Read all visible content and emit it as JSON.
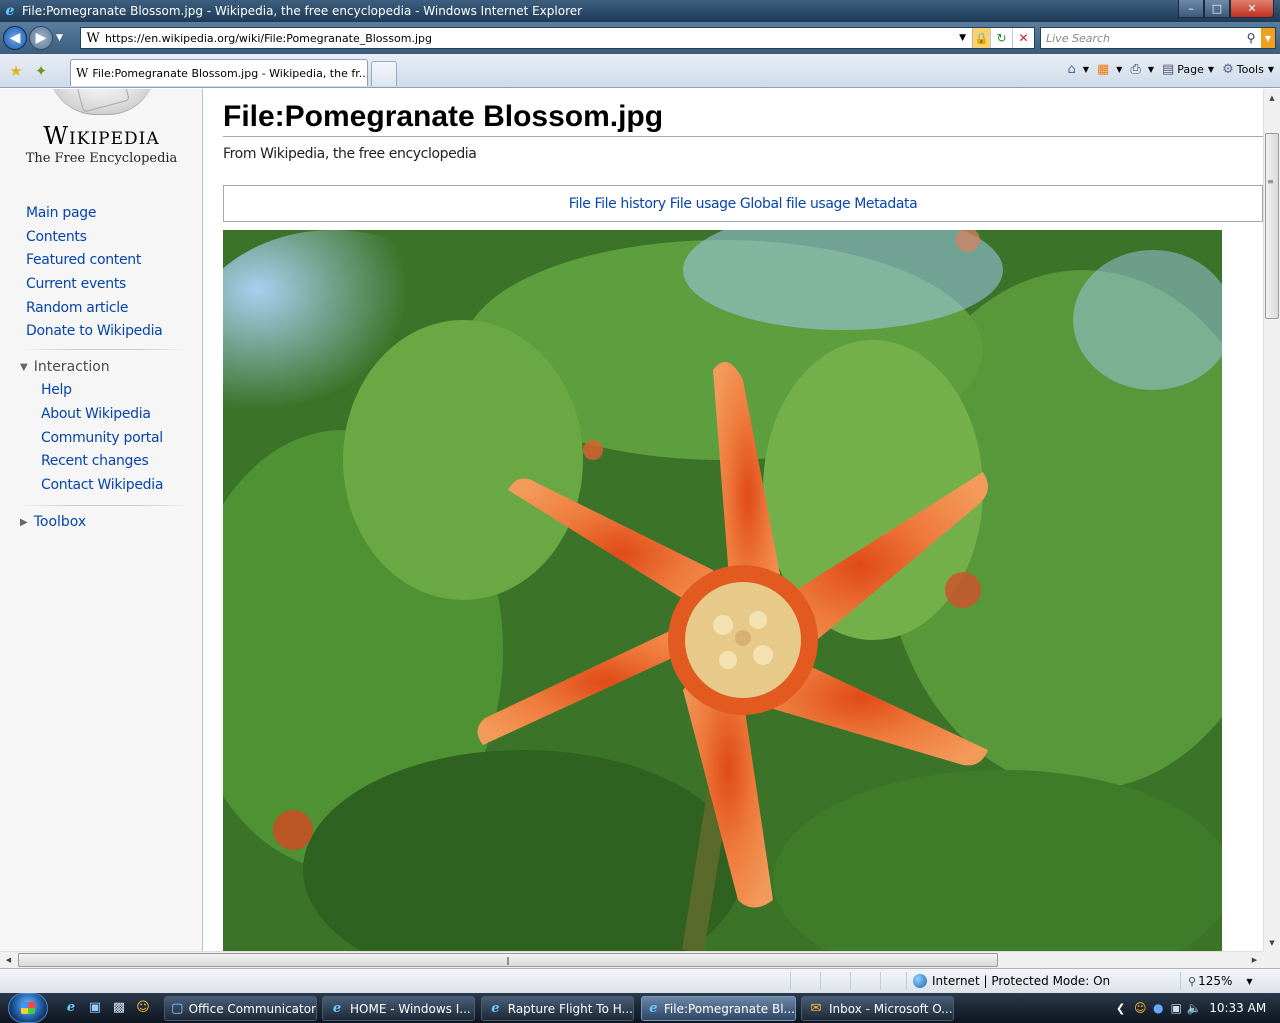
{
  "window": {
    "title": "File:Pomegranate Blossom.jpg - Wikipedia, the free encyclopedia - Windows Internet Explorer"
  },
  "address_bar": {
    "url": "https://en.wikipedia.org/wiki/File:Pomegranate_Blossom.jpg",
    "search_placeholder": "Live Search"
  },
  "tabs": [
    {
      "label": "File:Pomegranate Blossom.jpg - Wikipedia, the fr..."
    }
  ],
  "command_bar": {
    "page_label": "Page",
    "tools_label": "Tools"
  },
  "sidebar": {
    "wordmark": "Wikipedia",
    "tagline": "The Free Encyclopedia",
    "navigation": [
      {
        "label": "Main page"
      },
      {
        "label": "Contents"
      },
      {
        "label": "Featured content"
      },
      {
        "label": "Current events"
      },
      {
        "label": "Random article"
      },
      {
        "label": "Donate to Wikipedia"
      }
    ],
    "interaction_heading": "Interaction",
    "interaction": [
      {
        "label": "Help"
      },
      {
        "label": "About Wikipedia"
      },
      {
        "label": "Community portal"
      },
      {
        "label": "Recent changes"
      },
      {
        "label": "Contact Wikipedia"
      }
    ],
    "toolbox_heading": "Toolbox"
  },
  "content": {
    "page_title": "File:Pomegranate Blossom.jpg",
    "site_sub": "From Wikipedia, the free encyclopedia",
    "file_toc": [
      {
        "label": "File"
      },
      {
        "label": "File history"
      },
      {
        "label": "File usage"
      },
      {
        "label": "Global file usage"
      },
      {
        "label": "Metadata"
      }
    ]
  },
  "statusbar": {
    "zone": "Internet | Protected Mode: On",
    "zoom": "125%"
  },
  "taskbar": {
    "buttons": [
      {
        "label": "Office Communicator"
      },
      {
        "label": "HOME - Windows I..."
      },
      {
        "label": "Rapture Flight To H..."
      },
      {
        "label": "File:Pomegranate Bl..."
      },
      {
        "label": "Inbox - Microsoft O..."
      }
    ],
    "clock": "10:33 AM"
  },
  "colors": {
    "link": "#0645ad",
    "sidebar_bg": "#f6f6f6",
    "petal": "#e8702a"
  }
}
